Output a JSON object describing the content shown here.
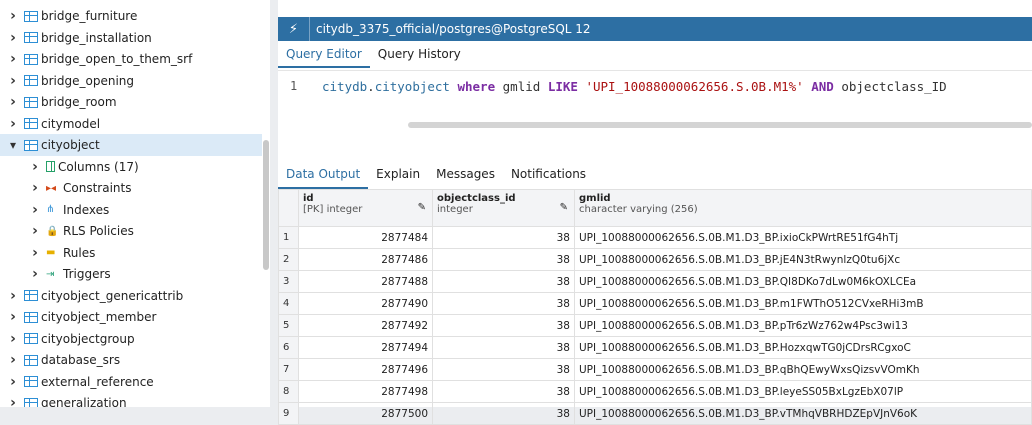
{
  "tree": {
    "items": [
      {
        "label": "bridge_furniture",
        "kind": "table",
        "indent": 0,
        "expanded": false
      },
      {
        "label": "bridge_installation",
        "kind": "table",
        "indent": 0,
        "expanded": false
      },
      {
        "label": "bridge_open_to_them_srf",
        "kind": "table",
        "indent": 0,
        "expanded": false
      },
      {
        "label": "bridge_opening",
        "kind": "table",
        "indent": 0,
        "expanded": false
      },
      {
        "label": "bridge_room",
        "kind": "table",
        "indent": 0,
        "expanded": false
      },
      {
        "label": "citymodel",
        "kind": "table",
        "indent": 0,
        "expanded": false
      },
      {
        "label": "cityobject",
        "kind": "table",
        "indent": 0,
        "expanded": true,
        "selected": true
      },
      {
        "label": "Columns (17)",
        "kind": "columns",
        "indent": 1,
        "expanded": false
      },
      {
        "label": "Constraints",
        "kind": "constraints",
        "indent": 1,
        "expanded": false
      },
      {
        "label": "Indexes",
        "kind": "indexes",
        "indent": 1,
        "expanded": false
      },
      {
        "label": "RLS Policies",
        "kind": "rls",
        "indent": 1,
        "expanded": false
      },
      {
        "label": "Rules",
        "kind": "rules",
        "indent": 1,
        "expanded": false
      },
      {
        "label": "Triggers",
        "kind": "triggers",
        "indent": 1,
        "expanded": false
      },
      {
        "label": "cityobject_genericattrib",
        "kind": "table",
        "indent": 0,
        "expanded": false
      },
      {
        "label": "cityobject_member",
        "kind": "table",
        "indent": 0,
        "expanded": false
      },
      {
        "label": "cityobjectgroup",
        "kind": "table",
        "indent": 0,
        "expanded": false
      },
      {
        "label": "database_srs",
        "kind": "table",
        "indent": 0,
        "expanded": false
      },
      {
        "label": "external_reference",
        "kind": "table",
        "indent": 0,
        "expanded": false
      },
      {
        "label": "generalization",
        "kind": "table",
        "indent": 0,
        "expanded": false
      }
    ]
  },
  "panel": {
    "title": "citydb_3375_official/postgres@PostgreSQL 12",
    "query_tabs": [
      "Query Editor",
      "Query History"
    ],
    "editor": {
      "line_number": "1",
      "code_parts": [
        {
          "t": "citydb",
          "c": "tb"
        },
        {
          "t": ".",
          "c": ""
        },
        {
          "t": "cityobject",
          "c": "tb"
        },
        {
          "t": " ",
          "c": ""
        },
        {
          "t": "where",
          "c": "kw"
        },
        {
          "t": " gmlid ",
          "c": ""
        },
        {
          "t": "LIKE",
          "c": "kw"
        },
        {
          "t": " ",
          "c": ""
        },
        {
          "t": "'UPI_10088000062656.S.0B.M1%'",
          "c": "st"
        },
        {
          "t": " ",
          "c": ""
        },
        {
          "t": "AND",
          "c": "kw"
        },
        {
          "t": " objectclass_ID",
          "c": ""
        }
      ]
    },
    "result_tabs": [
      "Data Output",
      "Explain",
      "Messages",
      "Notifications"
    ],
    "columns": [
      {
        "name": "id",
        "type": "[PK] integer"
      },
      {
        "name": "objectclass_id",
        "type": "integer"
      },
      {
        "name": "gmlid",
        "type": "character varying (256)"
      }
    ],
    "rows": [
      {
        "n": "1",
        "id": "2877484",
        "oc": "38",
        "gmlid": "UPI_10088000062656.S.0B.M1.D3_BP.ixioCkPWrtRE51fG4hTj"
      },
      {
        "n": "2",
        "id": "2877486",
        "oc": "38",
        "gmlid": "UPI_10088000062656.S.0B.M1.D3_BP.jE4N3tRwynlzQ0tu6jXc"
      },
      {
        "n": "3",
        "id": "2877488",
        "oc": "38",
        "gmlid": "UPI_10088000062656.S.0B.M1.D3_BP.QI8DKo7dLw0M6kOXLCEa"
      },
      {
        "n": "4",
        "id": "2877490",
        "oc": "38",
        "gmlid": "UPI_10088000062656.S.0B.M1.D3_BP.m1FWThO512CVxeRHi3mB"
      },
      {
        "n": "5",
        "id": "2877492",
        "oc": "38",
        "gmlid": "UPI_10088000062656.S.0B.M1.D3_BP.pTr6zWz762w4Psc3wi13"
      },
      {
        "n": "6",
        "id": "2877494",
        "oc": "38",
        "gmlid": "UPI_10088000062656.S.0B.M1.D3_BP.HozxqwTG0jCDrsRCgxoC"
      },
      {
        "n": "7",
        "id": "2877496",
        "oc": "38",
        "gmlid": "UPI_10088000062656.S.0B.M1.D3_BP.qBhQEwyWxsQizsvVOmKh"
      },
      {
        "n": "8",
        "id": "2877498",
        "oc": "38",
        "gmlid": "UPI_10088000062656.S.0B.M1.D3_BP.leyeSS05BxLgzEbX07lP"
      },
      {
        "n": "9",
        "id": "2877500",
        "oc": "38",
        "gmlid": "UPI_10088000062656.S.0B.M1.D3_BP.vTMhqVBRHDZEpVJnV6oK"
      }
    ]
  }
}
